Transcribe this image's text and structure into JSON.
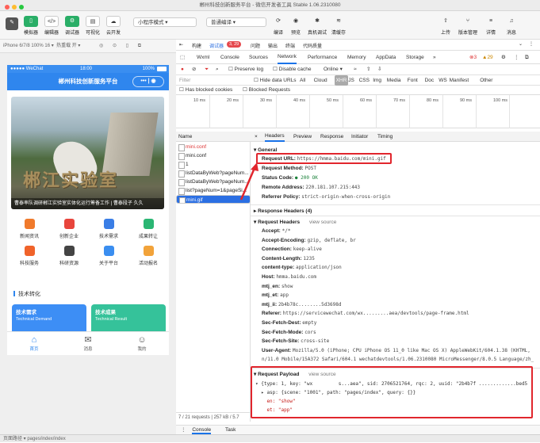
{
  "window": {
    "title": "郴州科技创新服务平台 - 微信开发者工具 Stable 1.06.2310080"
  },
  "toolbar": {
    "buttons": [
      {
        "label": "模拟器"
      },
      {
        "label": "编辑器"
      },
      {
        "label": "调试器"
      },
      {
        "label": "可视化"
      },
      {
        "label": "云开发"
      }
    ],
    "mode_select": "小程序模式",
    "compile_select": "普通编译",
    "actions": [
      {
        "label": "编译"
      },
      {
        "label": "预览"
      },
      {
        "label": "真机调试"
      },
      {
        "label": "清缓存"
      }
    ],
    "right": [
      {
        "label": "上传"
      },
      {
        "label": "版本管理"
      },
      {
        "label": "详情"
      },
      {
        "label": "消息"
      }
    ]
  },
  "simulator": {
    "device": "iPhone 6/7/8 100% 16 ▾",
    "hotreload": "热重载 开 ▾"
  },
  "phone": {
    "carrier": "●●●●● WeChat",
    "time": "18:00",
    "battery": "100%",
    "nav_title": "郴州科技创新服务平台",
    "banner_text": "郴江实验室",
    "banner_caption": "曹泰率队调研郴江实验室实体化运行筹备工作 | 曹泰段子 久久",
    "grid": [
      {
        "label": "新闻资讯",
        "color": "#f07a2c"
      },
      {
        "label": "创新企业",
        "color": "#e8453c"
      },
      {
        "label": "技术需求",
        "color": "#3a7ee6"
      },
      {
        "label": "成果转让",
        "color": "#2bb673"
      },
      {
        "label": "科技服务",
        "color": "#f0632a"
      },
      {
        "label": "科研资源",
        "color": "#444444"
      },
      {
        "label": "关于平台",
        "color": "#3a8ef0"
      },
      {
        "label": "活动报名",
        "color": "#f2a33a"
      }
    ],
    "section_title": "技术转化",
    "cards": [
      {
        "title": "技术需求",
        "sub": "Technical Demand",
        "color": "#3d8ef5"
      },
      {
        "title": "技术成果",
        "sub": "Technical Result",
        "color": "#35c29a"
      }
    ],
    "tabs": [
      {
        "label": "首页",
        "icon": "⌂"
      },
      {
        "label": "消息",
        "icon": "✉"
      },
      {
        "label": "我的",
        "icon": "☺"
      }
    ]
  },
  "devtools": {
    "top_tabs": [
      "构建",
      "调试器",
      "问题",
      "输出",
      "终端",
      "代码质量"
    ],
    "badge": "3, 29",
    "panel_tabs": [
      "Wxml",
      "Console",
      "Sources",
      "Network",
      "Performance",
      "Memory",
      "AppData",
      "Storage",
      "»"
    ],
    "active_panel": "Network",
    "errors": "3",
    "warnings": "29",
    "net_options": {
      "preserve": "Preserve log",
      "disable_cache": "Disable cache",
      "throttle": "Online"
    },
    "filter": {
      "placeholder": "Filter",
      "hide_data": "Hide data URLs",
      "types": [
        "All",
        "Cloud",
        "XHR",
        "JS",
        "CSS",
        "Img",
        "Media",
        "Font",
        "Doc",
        "WS",
        "Manifest",
        "Other"
      ]
    },
    "blocked": {
      "cookies": "Has blocked cookies",
      "requests": "Blocked Requests"
    },
    "timeline_ticks": [
      "10 ms",
      "20 ms",
      "30 ms",
      "40 ms",
      "50 ms",
      "60 ms",
      "70 ms",
      "80 ms",
      "90 ms",
      "100 ms"
    ],
    "requests_header": "Name",
    "requests": [
      {
        "name": "mini.conf",
        "state": "red"
      },
      {
        "name": "mini.conf",
        "state": "normal"
      },
      {
        "name": "1",
        "state": "normal"
      },
      {
        "name": "listDataByWeb?pageNum...",
        "state": "normal"
      },
      {
        "name": "listDataByWeb?pageNum...",
        "state": "normal"
      },
      {
        "name": "list?pageNum=1&pageSi...",
        "state": "normal"
      },
      {
        "name": "mini.gif",
        "state": "selected"
      }
    ],
    "footer": "7 / 21 requests | 257 kB / 5.7",
    "detail_tabs": [
      "×",
      "Headers",
      "Preview",
      "Response",
      "Initiator",
      "Timing"
    ],
    "general": {
      "title": "▾ General",
      "url_label": "Request URL:",
      "url": "https://hmma.baidu.com/mini.gif",
      "method_label": "Request Method:",
      "method": "POST",
      "status_label": "Status Code:",
      "status": "● 200 OK",
      "remote_label": "Remote Address:",
      "remote": "220.181.107.215:443",
      "policy_label": "Referrer Policy:",
      "policy": "strict-origin-when-cross-origin"
    },
    "response_headers": "▸ Response Headers (4)",
    "request_headers": {
      "title": "▾ Request Headers",
      "view": "view source",
      "rows": [
        {
          "k": "Accept:",
          "v": "*/*"
        },
        {
          "k": "Accept-Encoding:",
          "v": "gzip, deflate, br"
        },
        {
          "k": "Connection:",
          "v": "keep-alive"
        },
        {
          "k": "Content-Length:",
          "v": "1235"
        },
        {
          "k": "content-type:",
          "v": "application/json"
        },
        {
          "k": "Host:",
          "v": "hmma.baidu.com"
        },
        {
          "k": "mtj_en:",
          "v": "show"
        },
        {
          "k": "mtj_et:",
          "v": "app"
        },
        {
          "k": "mtj_ii:",
          "v": "2b4b78c........5d3698d"
        },
        {
          "k": "Referer:",
          "v": "https://servicewechat.com/wx.........aea/devtools/page-frame.html"
        },
        {
          "k": "Sec-Fetch-Dest:",
          "v": "empty"
        },
        {
          "k": "Sec-Fetch-Mode:",
          "v": "cors"
        },
        {
          "k": "Sec-Fetch-Site:",
          "v": "cross-site"
        },
        {
          "k": "User-Agent:",
          "v": "Mozilla/5.0 (iPhone; CPU iPhone OS 11_0 like Mac OS X) AppleWebKit/604.1.38 (KHTML,"
        },
        {
          "k": "",
          "v": "n/11.0 Mobile/15A372 Safari/604.1 wechatdevtools/1.06.2310080 MicroMessenger/8.0.5 Language/zh_"
        }
      ]
    },
    "payload": {
      "title": "▾ Request Payload",
      "view": "view source",
      "lines": [
        "▾ {type: 1, key: \"wx         s...aea\", sid: 2706521764, rqc: 2, uuid: \"2b4b7f .............bed5",
        "  ▸ asp: {scene: \"1001\", path: \"pages/index\", query: {}}",
        "    en: \"show\"",
        "    et: \"app\""
      ]
    },
    "console_tabs": [
      "Console",
      "Task"
    ]
  },
  "bottom": {
    "path": "页面路径 ▾   pages/index/index"
  }
}
